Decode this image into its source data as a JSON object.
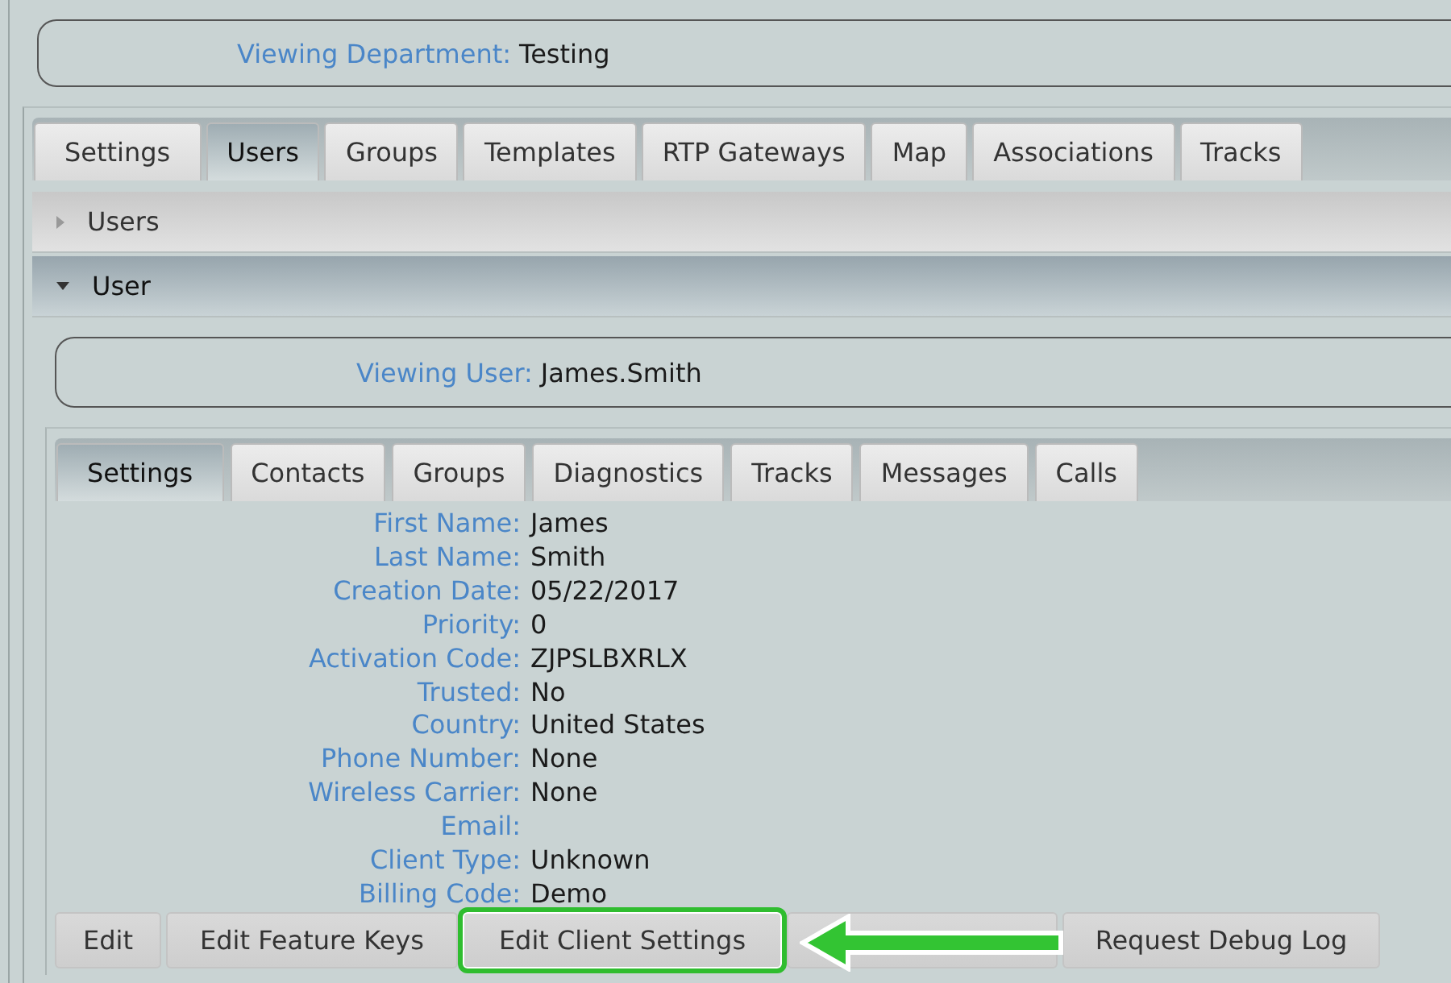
{
  "department": {
    "label": "Viewing Department:",
    "value": "Testing"
  },
  "tabs": [
    {
      "label": "Settings",
      "selected": false
    },
    {
      "label": "Users",
      "selected": true
    },
    {
      "label": "Groups",
      "selected": false
    },
    {
      "label": "Templates",
      "selected": false
    },
    {
      "label": "RTP Gateways",
      "selected": false
    },
    {
      "label": "Map",
      "selected": false
    },
    {
      "label": "Associations",
      "selected": false
    },
    {
      "label": "Tracks",
      "selected": false
    }
  ],
  "sections": [
    {
      "label": "Users",
      "expanded": false
    },
    {
      "label": "User",
      "expanded": true
    }
  ],
  "user": {
    "label": "Viewing User:",
    "value": "James.Smith"
  },
  "user_tabs": [
    {
      "label": "Settings",
      "selected": true
    },
    {
      "label": "Contacts",
      "selected": false
    },
    {
      "label": "Groups",
      "selected": false
    },
    {
      "label": "Diagnostics",
      "selected": false
    },
    {
      "label": "Tracks",
      "selected": false
    },
    {
      "label": "Messages",
      "selected": false
    },
    {
      "label": "Calls",
      "selected": false
    }
  ],
  "fields": [
    {
      "label": "First Name:",
      "value": "James"
    },
    {
      "label": "Last Name:",
      "value": "Smith"
    },
    {
      "label": "Creation Date:",
      "value": "05/22/2017"
    },
    {
      "label": "Priority:",
      "value": "0"
    },
    {
      "label": "Activation Code:",
      "value": "ZJPSLBXRLX"
    },
    {
      "label": "Trusted:",
      "value": "No"
    },
    {
      "label": "Country:",
      "value": "United States"
    },
    {
      "label": "Phone Number:",
      "value": "None"
    },
    {
      "label": "Wireless Carrier:",
      "value": "None"
    },
    {
      "label": "Email:"
    },
    {
      "label": "Client Type:",
      "value": "Unknown"
    },
    {
      "label": "Billing Code:",
      "value": "Demo"
    }
  ],
  "buttons": [
    {
      "label": "Edit",
      "highlighted": false
    },
    {
      "label": "Edit Feature Keys",
      "highlighted": false
    },
    {
      "label": "Edit Client Settings",
      "highlighted": true
    },
    {
      "highlighted": false
    },
    {
      "label": "Request Debug Log",
      "highlighted": false
    }
  ]
}
